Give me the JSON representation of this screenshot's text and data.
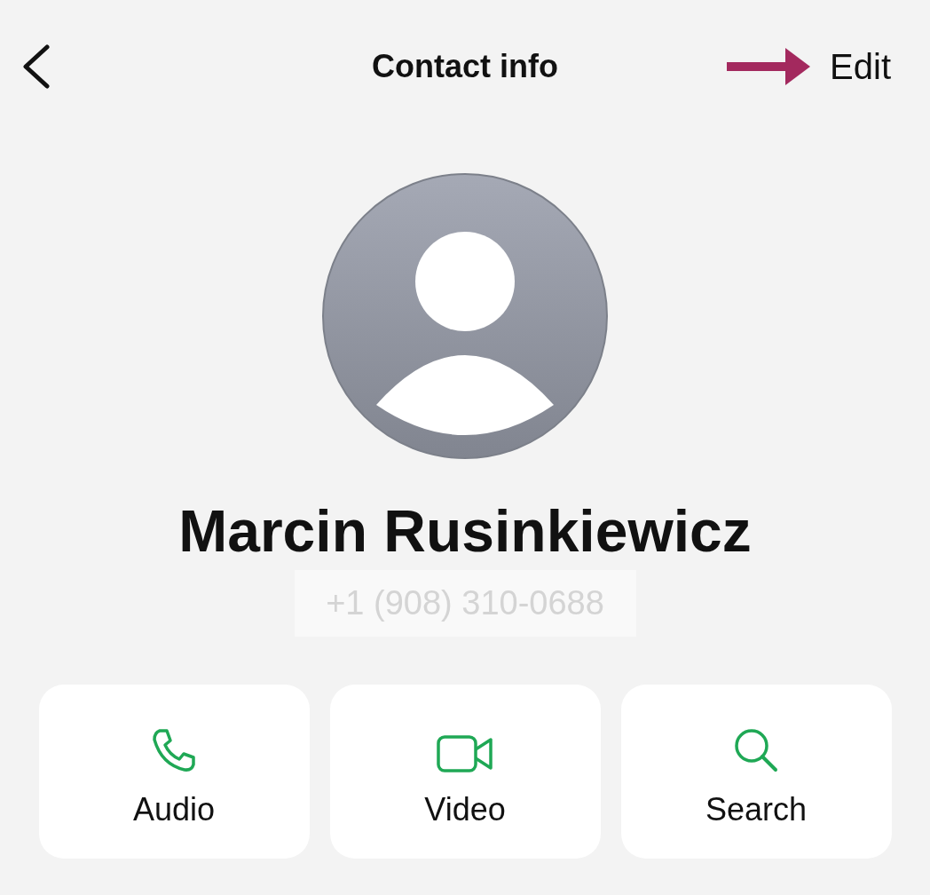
{
  "header": {
    "title": "Contact info",
    "edit": "Edit"
  },
  "contact": {
    "name": "Marcin Rusinkiewicz",
    "phone": "+1 (908) 310-0688"
  },
  "actions": [
    {
      "kind": "phone",
      "label": "Audio"
    },
    {
      "kind": "video",
      "label": "Video"
    },
    {
      "kind": "search",
      "label": "Search"
    }
  ]
}
